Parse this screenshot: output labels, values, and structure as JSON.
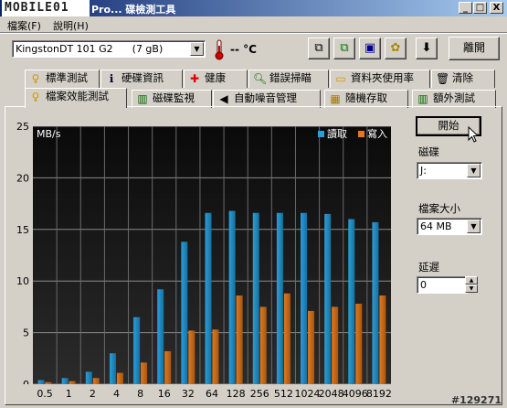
{
  "window": {
    "logo": "MOBILE01",
    "title": "Pro... 碟檢測工具",
    "buttons": {
      "minimize": "_",
      "maximize": "□",
      "close": "X"
    }
  },
  "menu": [
    {
      "label": "檔案(F)"
    },
    {
      "label": "說明(H)"
    }
  ],
  "toolbar": {
    "drive": "KingstonDT 101 G2      (7 gB)",
    "temperature": "-- °C",
    "exit_label": "離開"
  },
  "tabs_top": [
    "標準測試",
    "硬碟資訊",
    "健康",
    "錯誤掃瞄",
    "資料夾使用率",
    "清除"
  ],
  "tabs_bottom": [
    "檔案效能測試",
    "磁碟監視",
    "自動噪音管理",
    "隨機存取",
    "額外測試"
  ],
  "side": {
    "start_label": "開始",
    "disk_label": "磁碟",
    "disk_value": "J:",
    "filesize_label": "檔案大小",
    "filesize_value": "64 MB",
    "delay_label": "延遲",
    "delay_value": "0"
  },
  "watermark": "#129271",
  "chart_data": {
    "type": "bar",
    "ylabel": "MB/s",
    "ylim": [
      0,
      25
    ],
    "yticks": [
      0,
      5,
      10,
      15,
      20,
      25
    ],
    "categories": [
      "0.5",
      "1",
      "2",
      "4",
      "8",
      "16",
      "32",
      "64",
      "128",
      "256",
      "512",
      "1024",
      "2048",
      "4096",
      "8192"
    ],
    "series": [
      {
        "name": "讀取",
        "color": "#2b9ed8",
        "values": [
          0.4,
          0.6,
          1.2,
          3.0,
          6.5,
          9.2,
          13.8,
          16.6,
          16.8,
          16.6,
          16.6,
          16.6,
          16.5,
          16.0,
          15.7
        ]
      },
      {
        "name": "寫入",
        "color": "#e07a1e",
        "values": [
          0.2,
          0.3,
          0.6,
          1.1,
          2.1,
          3.2,
          5.2,
          5.3,
          8.6,
          7.5,
          8.8,
          7.1,
          7.5,
          7.8,
          8.6
        ]
      }
    ],
    "grid": true,
    "legend": "top-right"
  }
}
